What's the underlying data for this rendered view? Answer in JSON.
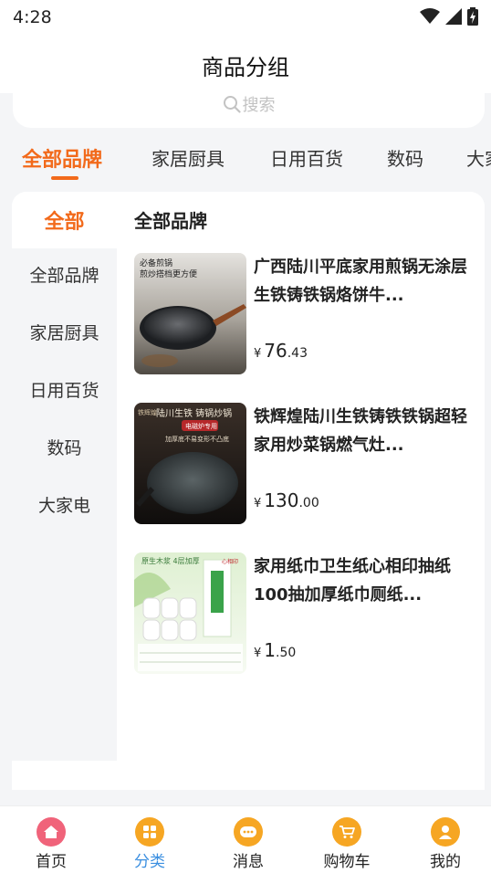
{
  "status_bar": {
    "time": "4:28",
    "icons": [
      "wifi-icon",
      "signal-icon",
      "battery-charging-icon"
    ]
  },
  "header": {
    "title": "商品分组"
  },
  "search": {
    "placeholder": "搜索",
    "icon": "search-icon"
  },
  "brand_tabs": [
    {
      "label": "全部品牌",
      "active": true
    },
    {
      "label": "家居厨具",
      "active": false
    },
    {
      "label": "日用百货",
      "active": false
    },
    {
      "label": "数码",
      "active": false
    },
    {
      "label": "大家",
      "active": false
    }
  ],
  "sidebar": {
    "header": "全部",
    "items": [
      {
        "label": "全部品牌"
      },
      {
        "label": "家居厨具"
      },
      {
        "label": "日用百货"
      },
      {
        "label": "数码"
      },
      {
        "label": "大家电"
      }
    ]
  },
  "main": {
    "section_title": "全部品牌",
    "products": [
      {
        "name": "广西陆川平底家用煎锅无涂层生铁铸铁锅烙饼牛...",
        "price_symbol": "¥",
        "price_int": "76",
        "price_dec": ".43",
        "thumb_text_1": "必备煎锅",
        "thumb_text_2": "煎炒搭档更方便"
      },
      {
        "name": "铁辉煌陆川生铁铸铁铁锅超轻家用炒菜锅燃气灶...",
        "price_symbol": "¥",
        "price_int": "130",
        "price_dec": ".00",
        "thumb_text_1": "陆川生铁 铸锅炒锅",
        "thumb_text_2": "电磁炉专用",
        "thumb_text_3": "加厚底不易变形不凸底",
        "thumb_text_4": "铁辉煌"
      },
      {
        "name": "家用纸巾卫生纸心相印抽纸100抽加厚纸巾厕纸...",
        "price_symbol": "¥",
        "price_int": "1",
        "price_dec": ".50",
        "thumb_text_1": "原生木浆 4层加厚",
        "thumb_text_2": "心相印"
      }
    ]
  },
  "tab_bar": [
    {
      "label": "首页",
      "icon": "home-icon",
      "color": "#f0637a",
      "active": false
    },
    {
      "label": "分类",
      "icon": "grid-icon",
      "color": "#f6a623",
      "active": true
    },
    {
      "label": "消息",
      "icon": "message-icon",
      "color": "#f6a623",
      "active": false
    },
    {
      "label": "购物车",
      "icon": "cart-icon",
      "color": "#f6a623",
      "active": false
    },
    {
      "label": "我的",
      "icon": "user-icon",
      "color": "#f6a623",
      "active": false
    }
  ],
  "colors": {
    "accent": "#f26a1b",
    "tab_active": "#3b8fe0",
    "background": "#f4f5f7"
  }
}
